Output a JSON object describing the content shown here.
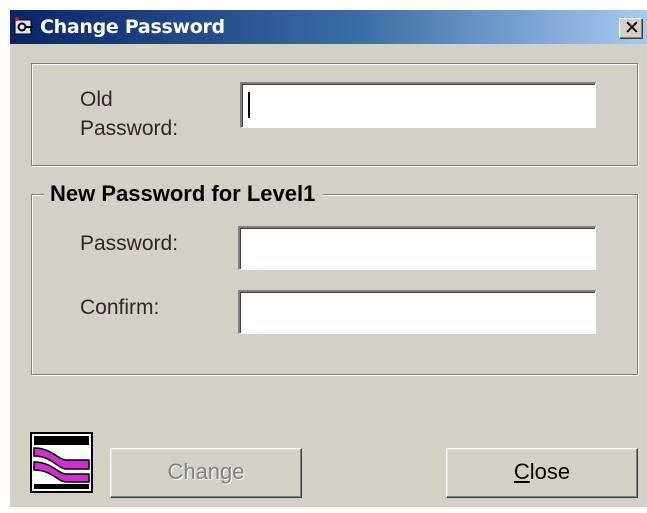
{
  "window": {
    "title": "Change Password",
    "close_glyph": "✕",
    "icon": "key-app-icon",
    "title_gradient": [
      "#0a246a",
      "#a6caf0"
    ],
    "face_color": "#d4d0c8"
  },
  "old_group": {
    "label_line1": "Old",
    "label_line2": "Password:",
    "value": ""
  },
  "new_group": {
    "legend": "New Password for Level1",
    "password_label": "Password:",
    "password_value": "",
    "confirm_label": "Confirm:",
    "confirm_value": ""
  },
  "footer": {
    "logo": "product-logo-icon",
    "change_label": "Change",
    "change_enabled": false,
    "close_label_mnemonic": "C",
    "close_label_rest": "lose"
  }
}
